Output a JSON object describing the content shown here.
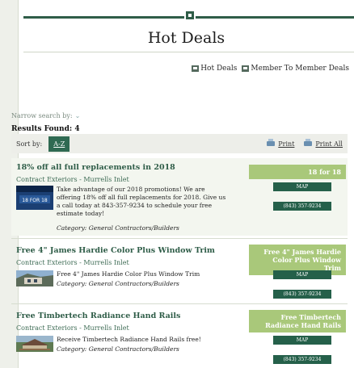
{
  "header": {
    "title": "Hot Deals"
  },
  "deal_links": [
    {
      "label": "Hot Deals",
      "icon": "hot-deals-icon"
    },
    {
      "label": "Member To Member Deals",
      "icon": "member-deals-icon"
    }
  ],
  "filters": {
    "narrow_label": "Narrow search by:",
    "results_label": "Results Found: 4",
    "sort_label": "Sort by:",
    "sort_button": "A-Z",
    "print_label": "Print",
    "print_all_label": "Print All"
  },
  "listings": [
    {
      "title": "18% off all full replacements in 2018",
      "company": "Contract Exteriors - Murrells Inlet",
      "description": "Take advantage of our 2018 promotions! We are offering 18% off all full replacements for 2018. Give us a call today at 843-357-9234 to schedule your free estimate today!",
      "category": "Category: General Contractors/Builders",
      "promo": "18 for 18",
      "thumb_text": "18 FOR 18",
      "map_label": "MAP",
      "phone": "(843) 357-9234"
    },
    {
      "title": "Free 4\" James Hardie Color Plus Window Trim",
      "company": "Contract Exteriors - Murrells Inlet",
      "description": "Free 4\" James Hardie Color Plus Window Trim",
      "category": "Category: General Contractors/Builders",
      "promo": "Free 4\" James Hardie Color Plus Window Trim",
      "map_label": "MAP",
      "phone": "(843) 357-9234"
    },
    {
      "title": "Free Timbertech Radiance Hand Rails",
      "company": "Contract Exteriors - Murrells Inlet",
      "description": "Receive Timbertech Radiance Hand Rails free!",
      "category": "Category: General Contractors/Builders",
      "promo": "Free Timbertech Radiance Hand Rails",
      "map_label": "MAP",
      "phone": "(843) 357-9234"
    }
  ],
  "colors": {
    "brand_green": "#2f5d48",
    "promo_green": "#a9c87a",
    "button_green": "#25604a"
  }
}
